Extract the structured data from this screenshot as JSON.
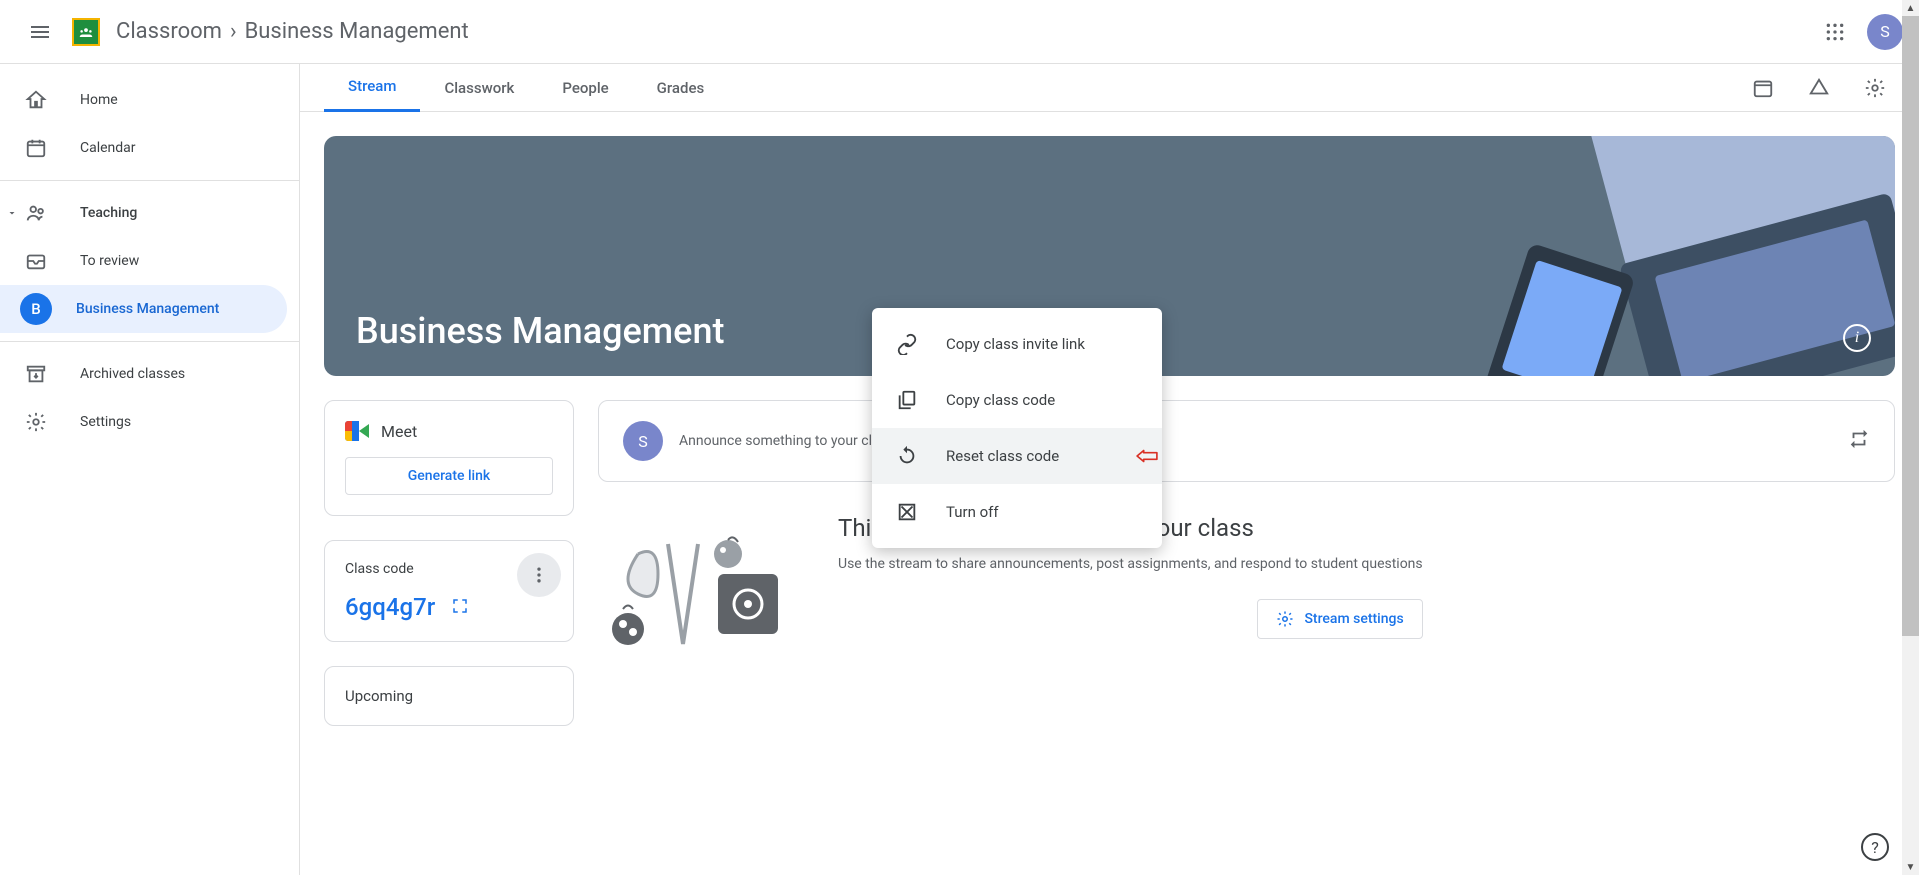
{
  "header": {
    "app_name": "Classroom",
    "breadcrumb_separator": "›",
    "class_name": "Business Management",
    "avatar_letter": "S"
  },
  "sidebar": {
    "home": "Home",
    "calendar": "Calendar",
    "teaching_section": "Teaching",
    "to_review": "To review",
    "class_item": "Business Management",
    "class_letter": "B",
    "archived": "Archived classes",
    "settings": "Settings"
  },
  "tabs": {
    "stream": "Stream",
    "classwork": "Classwork",
    "people": "People",
    "grades": "Grades"
  },
  "hero": {
    "title": "Business Management"
  },
  "meet": {
    "title": "Meet",
    "generate": "Generate link"
  },
  "code": {
    "label": "Class code",
    "value": "6gq4g7r"
  },
  "upcoming": {
    "title": "Upcoming"
  },
  "announce": {
    "placeholder": "Announce something to your class",
    "avatar_letter": "S"
  },
  "empty": {
    "heading": "This is where you can talk to your class",
    "body": "Use the stream to share announcements, post assignments, and respond to student questions",
    "settings_label": "Stream settings"
  },
  "popup": {
    "copy_link": "Copy class invite link",
    "copy_code": "Copy class code",
    "reset": "Reset class code",
    "turn_off": "Turn off"
  },
  "help": "?"
}
